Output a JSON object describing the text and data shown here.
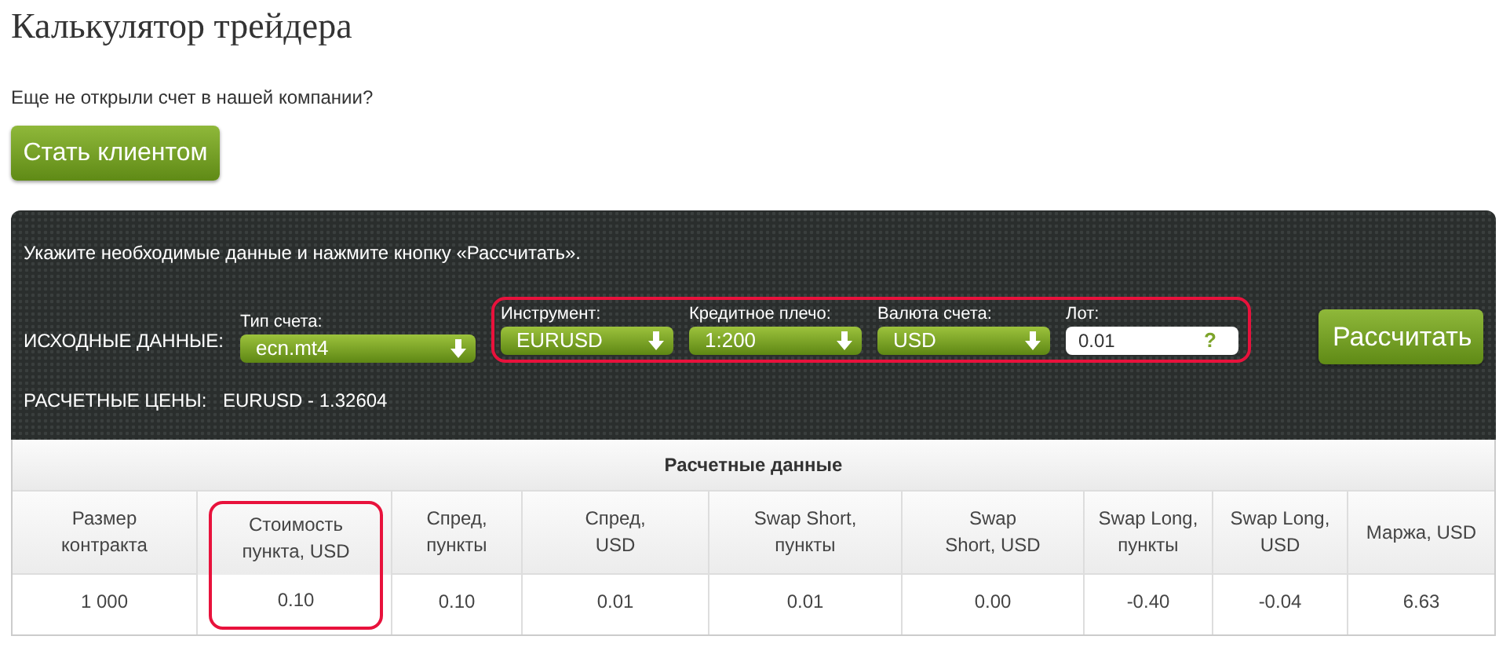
{
  "title": "Калькулятор трейдера",
  "intro": "Еще не открыли счет в нашей компании?",
  "client_button": "Стать клиентом",
  "panel": {
    "instruction": "Укажите необходимые данные и нажмите кнопку «Рассчитать».",
    "inputs_label": "ИСХОДНЫЕ ДАННЫЕ:",
    "fields": [
      {
        "kind": "select",
        "label": "Тип счета:",
        "value": "ecn.mt4",
        "highlighted": false
      },
      {
        "kind": "select",
        "label": "Инструмент:",
        "value": "EURUSD",
        "highlighted": true
      },
      {
        "kind": "select",
        "label": "Кредитное плечо:",
        "value": "1:200",
        "highlighted": true
      },
      {
        "kind": "select",
        "label": "Валюта счета:",
        "value": "USD",
        "highlighted": true
      },
      {
        "kind": "input",
        "label": "Лот:",
        "value": "0.01",
        "hint": "?",
        "highlighted": true
      }
    ],
    "calculate_button": "Рассчитать",
    "prices_label": "РАСЧЕТНЫЕ ЦЕНЫ:",
    "prices_value": "EURUSD - 1.32604"
  },
  "table": {
    "title": "Расчетные данные",
    "columns": [
      {
        "header": "Размер контракта",
        "value": "1 000",
        "highlighted": false
      },
      {
        "header": "Стоимость пункта, USD",
        "value": "0.10",
        "highlighted": true
      },
      {
        "header": "Спред, пункты",
        "value": "0.10",
        "highlighted": false
      },
      {
        "header": "Спред, USD",
        "value": "0.01",
        "highlighted": false
      },
      {
        "header": "Swap Short, пункты",
        "value": "0.01",
        "highlighted": false
      },
      {
        "header": "Swap Short, USD",
        "value": "0.00",
        "highlighted": false
      },
      {
        "header": "Swap Long, пункты",
        "value": "-0.40",
        "highlighted": false
      },
      {
        "header": "Swap Long, USD",
        "value": "-0.04",
        "highlighted": false
      },
      {
        "header": "Маржа, USD",
        "value": "6.63",
        "highlighted": false
      }
    ]
  }
}
